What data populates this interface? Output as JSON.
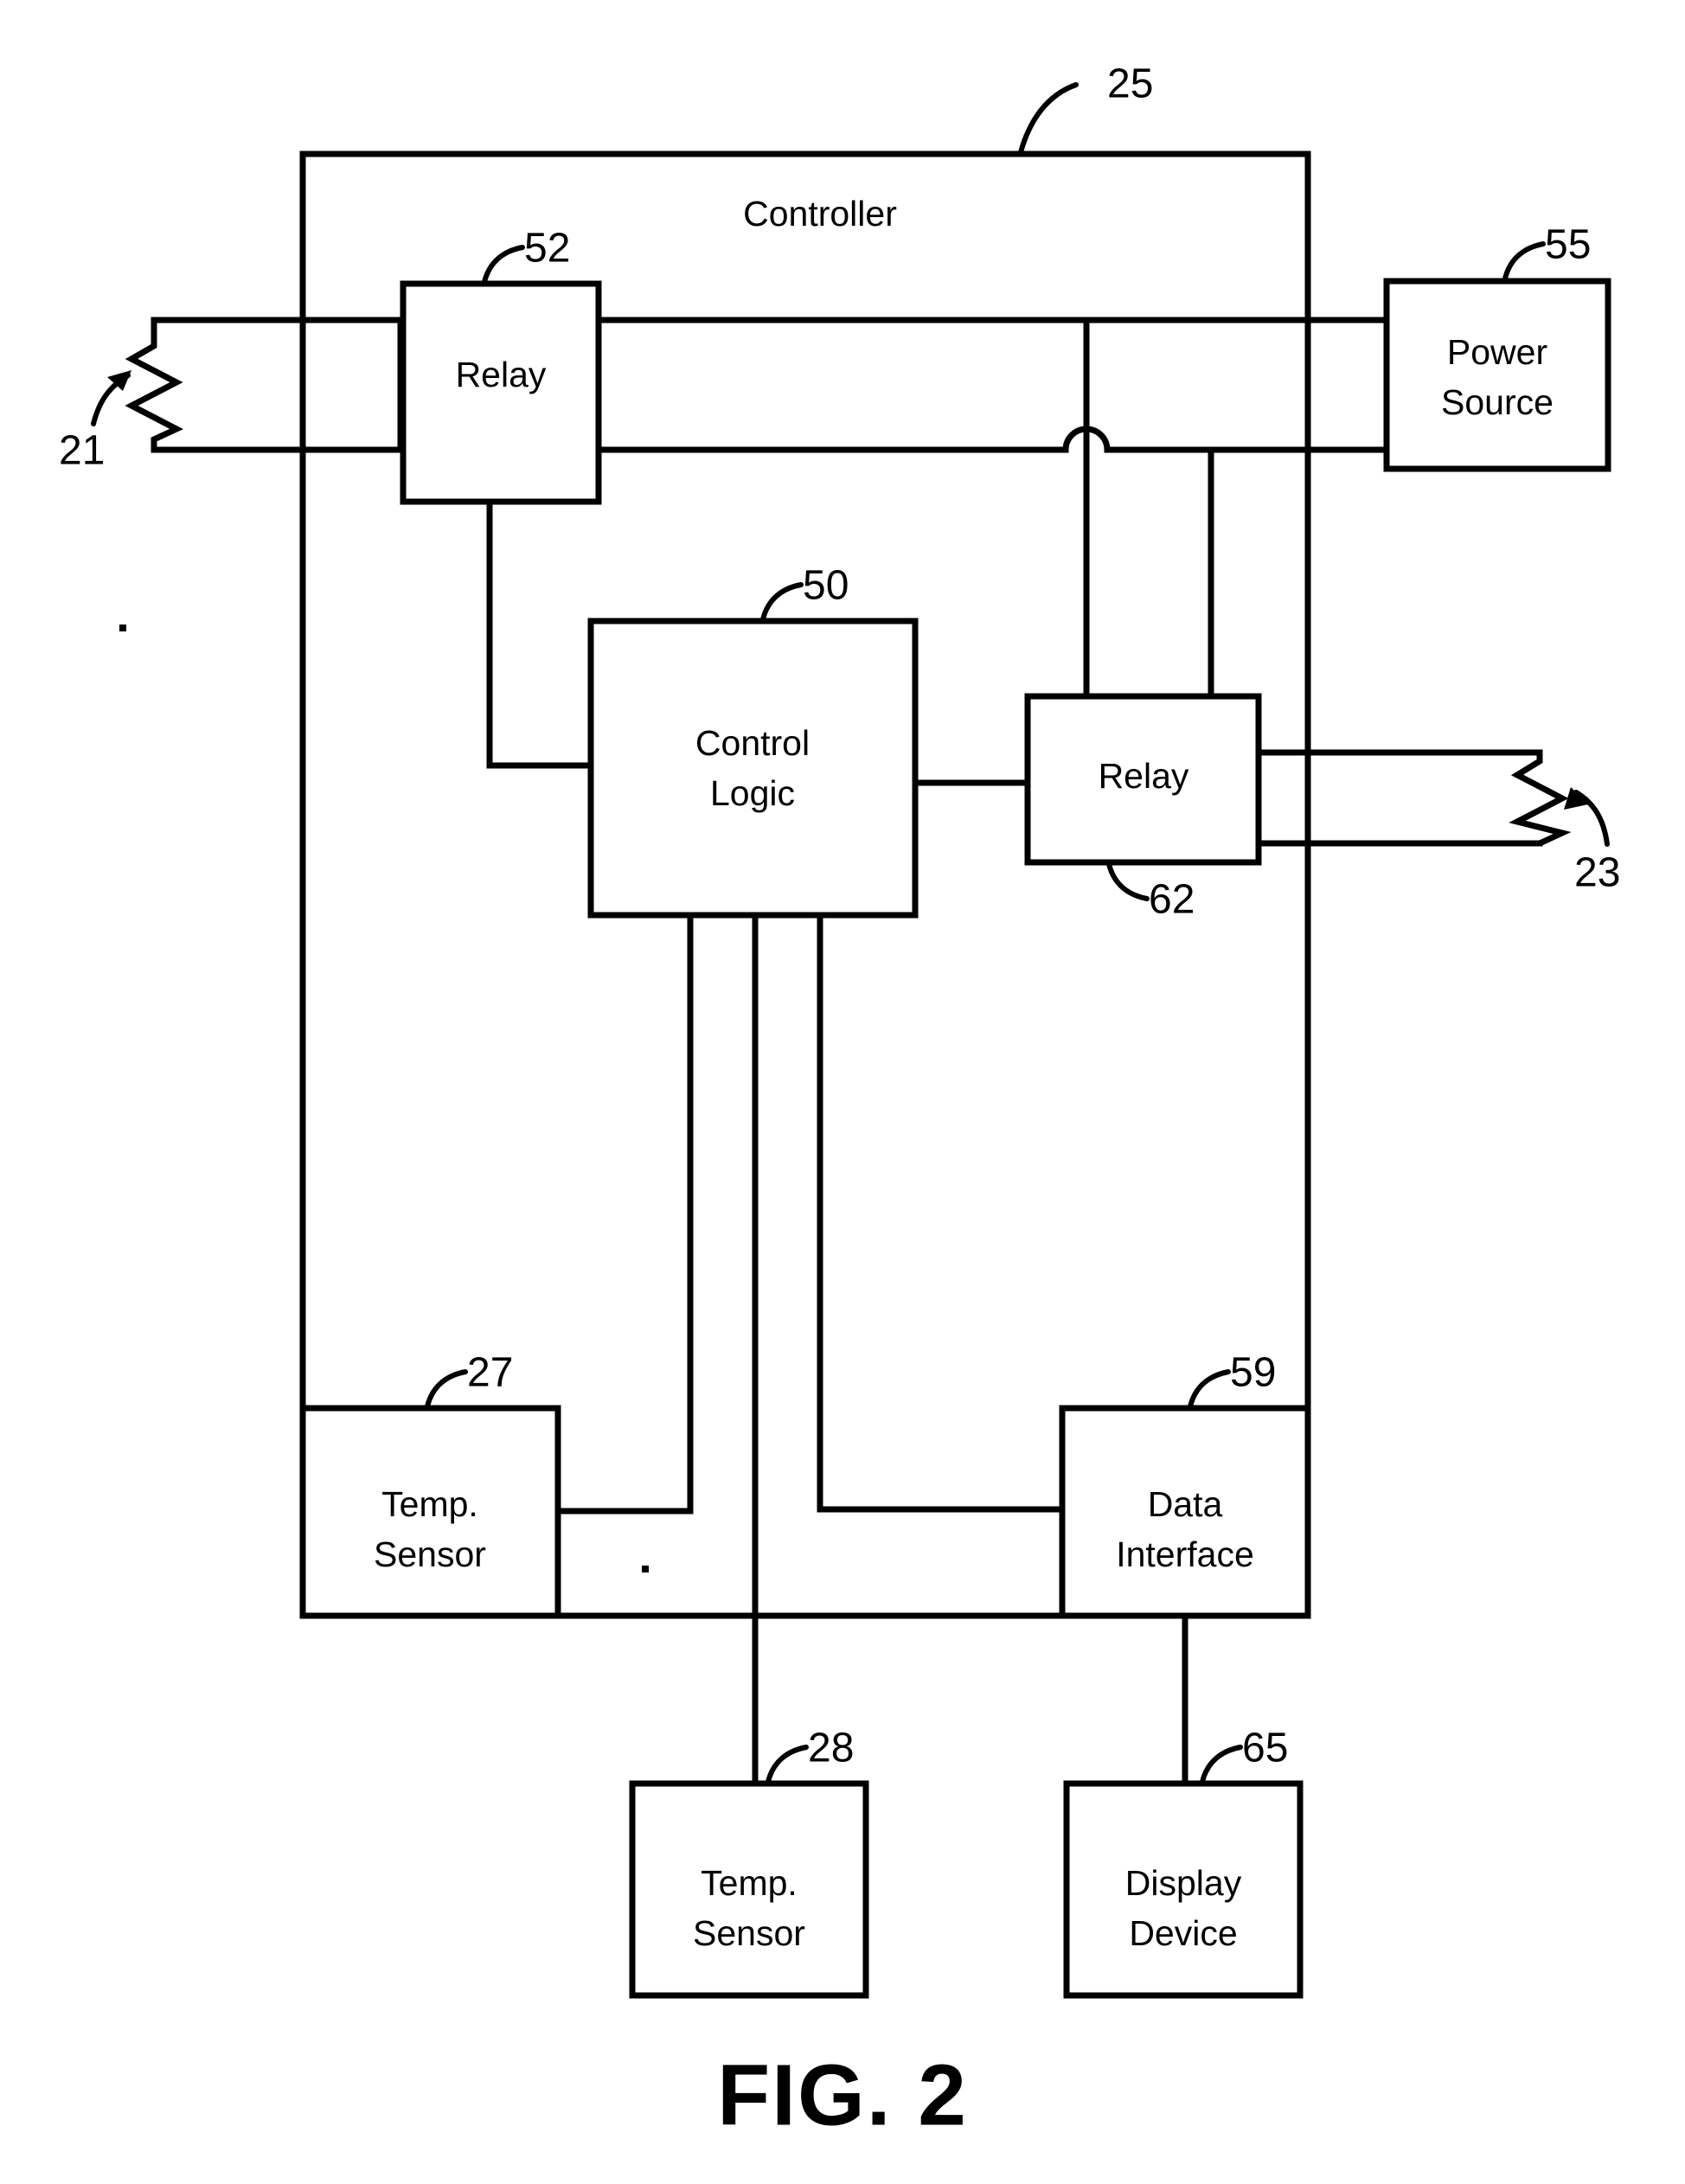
{
  "figure": {
    "caption": "FIG. 2",
    "title_block_label": "Controller"
  },
  "blocks": [
    {
      "id": "controller",
      "label": "Controller",
      "ref": "25",
      "multiline": false
    },
    {
      "id": "relay-52",
      "label": "Relay",
      "ref": "52",
      "multiline": false
    },
    {
      "id": "power-source",
      "label_line1": "Power",
      "label_line2": "Source",
      "ref": "55",
      "multiline": true
    },
    {
      "id": "control-logic",
      "label_line1": "Control",
      "label_line2": "Logic",
      "ref": "50",
      "multiline": true
    },
    {
      "id": "relay-62",
      "label": "Relay",
      "ref": "62",
      "multiline": false
    },
    {
      "id": "temp-sensor-27",
      "label_line1": "Temp.",
      "label_line2": "Sensor",
      "ref": "27",
      "multiline": true
    },
    {
      "id": "data-interface",
      "label_line1": "Data",
      "label_line2": "Interface",
      "ref": "59",
      "multiline": true
    },
    {
      "id": "temp-sensor-28",
      "label_line1": "Temp.",
      "label_line2": "Sensor",
      "ref": "28",
      "multiline": true
    },
    {
      "id": "display-device",
      "label_line1": "Display",
      "label_line2": "Device",
      "ref": "65",
      "multiline": true
    }
  ],
  "components": [
    {
      "id": "heating-element-21",
      "type": "resistor",
      "ref": "21",
      "side": "left"
    },
    {
      "id": "heating-element-23",
      "type": "resistor",
      "ref": "23",
      "side": "right"
    }
  ],
  "refs": {
    "r25": "25",
    "r52": "52",
    "r55": "55",
    "r50": "50",
    "r62": "62",
    "r27": "27",
    "r59": "59",
    "r28": "28",
    "r65": "65",
    "r21": "21",
    "r23": "23"
  },
  "labels": {
    "controller": "Controller",
    "relay": "Relay",
    "power_l1": "Power",
    "power_l2": "Source",
    "control_l1": "Control",
    "control_l2": "Logic",
    "temp_l1": "Temp.",
    "temp_l2": "Sensor",
    "data_l1": "Data",
    "data_l2": "Interface",
    "display_l1": "Display",
    "display_l2": "Device",
    "caption": "FIG. 2"
  },
  "colors": {
    "line": "#000000",
    "background": "#ffffff",
    "text": "#000000"
  }
}
